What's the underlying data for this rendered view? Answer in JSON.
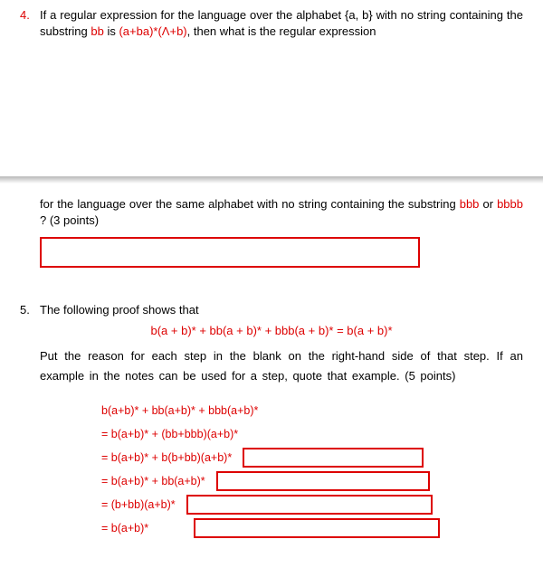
{
  "q4": {
    "number": "4.",
    "line1_pre": "If a regular expression for the language over the alphabet {a, b} with no string containing the substring ",
    "line1_bb": "bb",
    "line1_mid": " is ",
    "line1_expr": "(a+ba)*(Λ+b)",
    "line1_post": ", then what is the regular expression",
    "line2_pre": "for the language over the same alphabet with no string containing the substring ",
    "line2_b1": "bbb",
    "line2_or": " or ",
    "line2_b2": "bbbb",
    "line2_q": " ?",
    "points": "   (3 points)"
  },
  "q5": {
    "number": "5.",
    "intro": "The following proof shows that",
    "theorem": "b(a + b)* + bb(a + b)* + bbb(a + b)* = b(a + b)*",
    "instructions": "Put the reason for each step in the blank on the right-hand side of that step. If an example in the notes can be used for a step, quote that example. (5 points)",
    "steps": [
      "b(a+b)* + bb(a+b)* + bbb(a+b)*",
      "= b(a+b)* + (bb+bbb)(a+b)*",
      "= b(a+b)* + b(b+bb)(a+b)*",
      "= b(a+b)* + bb(a+b)*",
      "= (b+bb)(a+b)*",
      "= b(a+b)*"
    ]
  }
}
